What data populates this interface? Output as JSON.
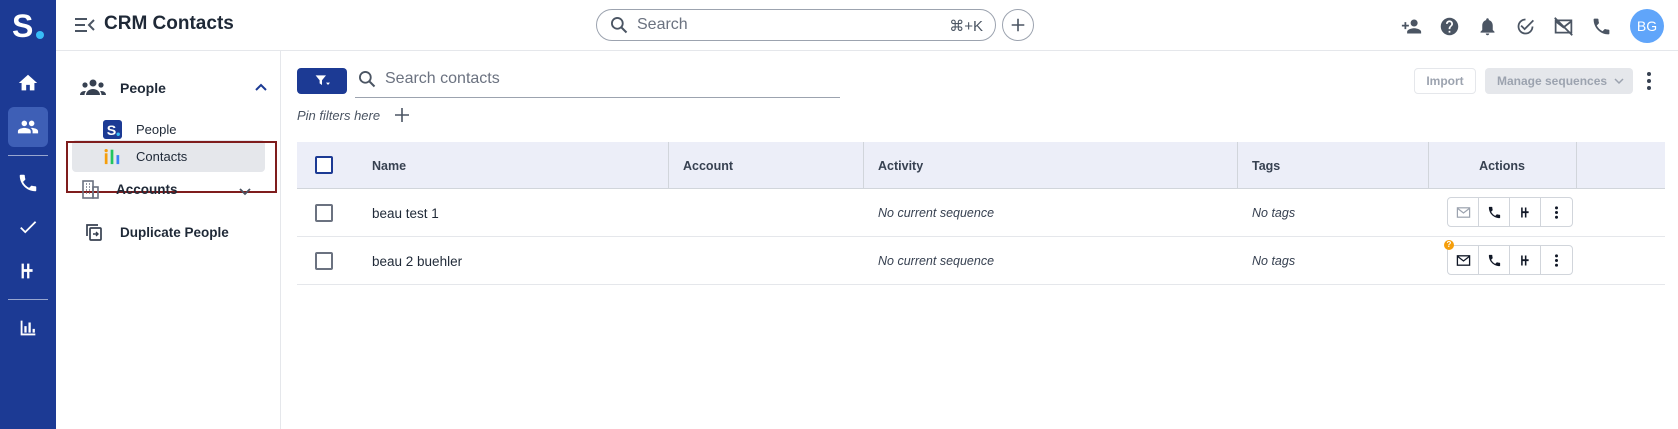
{
  "app": {
    "logo_letter": "S",
    "title": "CRM Contacts"
  },
  "search": {
    "placeholder": "Search",
    "shortcut": "⌘+K"
  },
  "user": {
    "initials": "BG"
  },
  "sidebar": {
    "group_people": "People",
    "items": [
      {
        "label": "People"
      },
      {
        "label": "Contacts"
      }
    ],
    "group_accounts": "Accounts",
    "duplicate": "Duplicate People"
  },
  "toolbar": {
    "search_placeholder": "Search contacts",
    "import_label": "Import",
    "manage_label": "Manage sequences",
    "pin_label": "Pin filters here"
  },
  "table": {
    "columns": [
      "Name",
      "Account",
      "Activity",
      "Tags",
      "Actions"
    ],
    "rows": [
      {
        "name": "beau test 1",
        "account": "",
        "activity": "No current sequence",
        "tags": "No tags",
        "badge": ""
      },
      {
        "name": "beau 2 buehler",
        "account": "",
        "activity": "No current sequence",
        "tags": "No tags",
        "badge": "?"
      }
    ]
  },
  "colors": {
    "brand": "#1c3a94",
    "rail_active": "#3e5fb6",
    "header_bg": "#eceef8",
    "highlight_border": "#7f1d1d",
    "avatar": "#60a5fa",
    "badge": "#f59e0b"
  }
}
